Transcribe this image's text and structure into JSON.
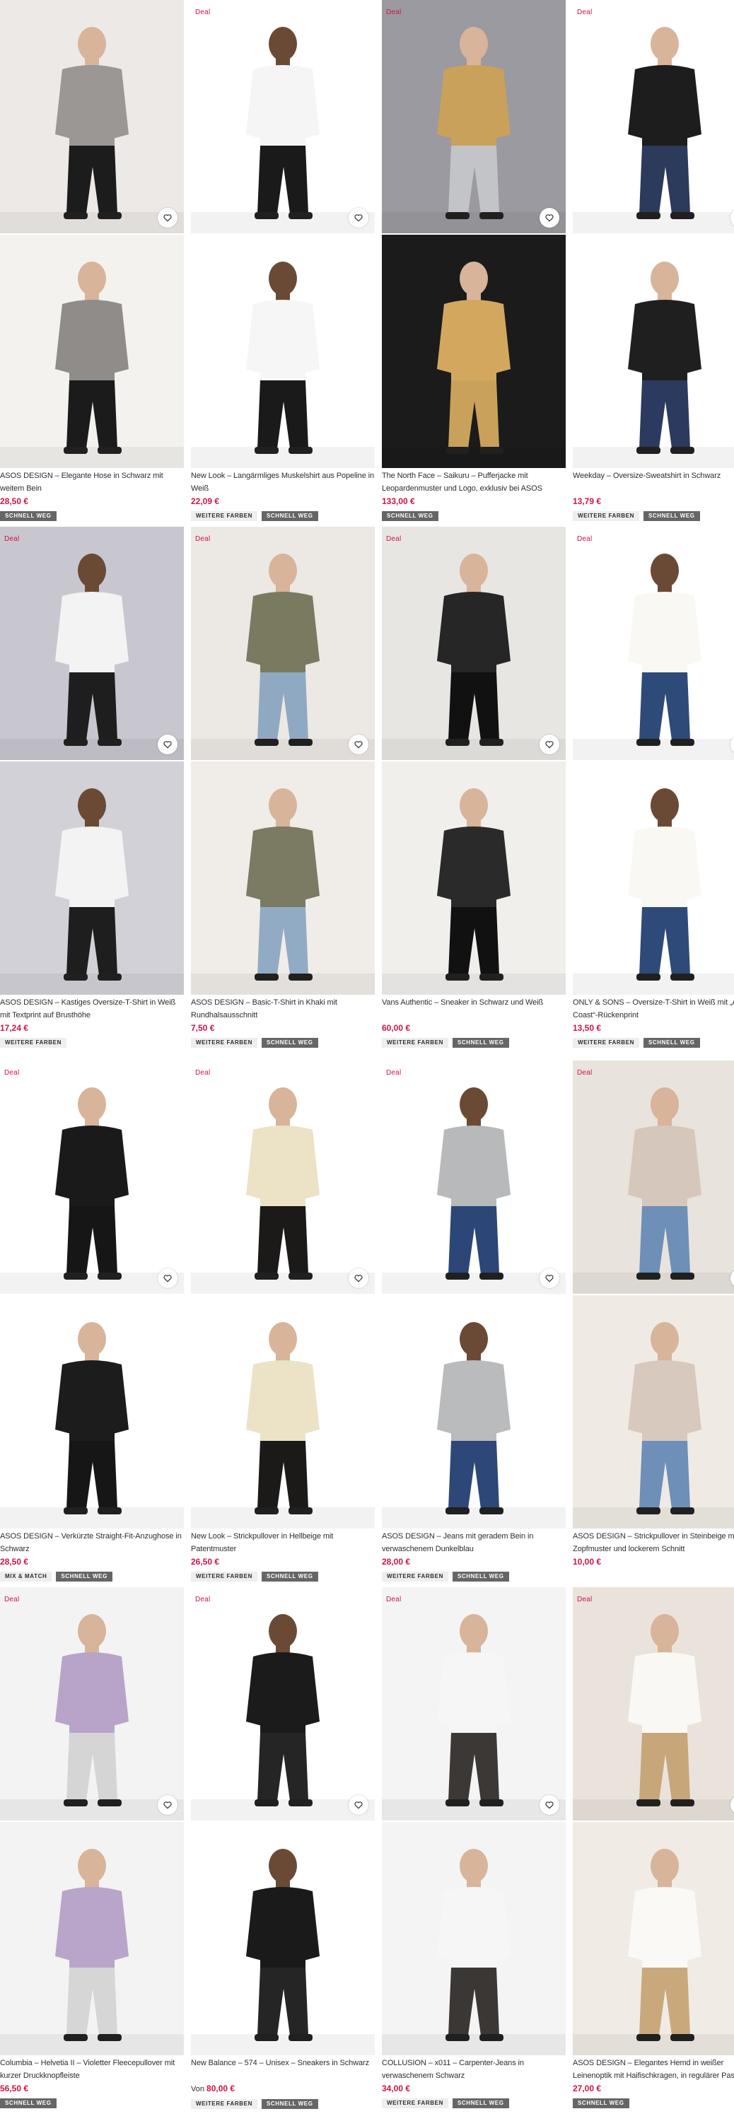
{
  "page": {
    "deal_label": "Deal"
  },
  "colors": {
    "deal_red": "#d01345",
    "text": "#2d2d2d",
    "badge_light": "#eeeeee",
    "badge_dark": "#666666"
  },
  "products": [
    {
      "name": "ASOS DESIGN – Elegante Hose in Schwarz mit weitem Bein",
      "price": "28,50 €",
      "from_label": "",
      "deal": false,
      "badges": [
        "SCHNELL WEG"
      ],
      "bg": "#ece9e6",
      "top": "#9a9795",
      "bottom": "#1d1c1c",
      "bg2": "#f4f2ef",
      "top2": "#8f8c8a",
      "bottom2": "#1c1b1b"
    },
    {
      "name": "New Look – Langärmliges Muskelshirt aus Popeline in Weiß",
      "price": "22,09 €",
      "from_label": "",
      "deal": true,
      "badges": [
        "WEITERE FARBEN",
        "SCHNELL WEG"
      ],
      "bg": "#ffffff",
      "top": "#f5f5f5",
      "bottom": "#1a1a1a",
      "bg2": "#ffffff",
      "top2": "#f6f6f6",
      "bottom2": "#1a1a1a"
    },
    {
      "name": "The North Face – Saikuru – Pufferjacke mit Leopardenmuster und Logo, exklusiv bei ASOS",
      "price": "133,00 €",
      "from_label": "",
      "deal": true,
      "badges": [
        "SCHNELL WEG"
      ],
      "bg": "#9a9aa0",
      "top": "#c9a15a",
      "bottom": "#c2c4c7",
      "bg2": "#1b1b1b",
      "top2": "#d3a85e",
      "bottom2": "#c9a15a"
    },
    {
      "name": "Weekday – Oversize-Sweatshirt in Schwarz",
      "price": "13,79 €",
      "from_label": "",
      "deal": true,
      "badges": [
        "WEITERE FARBEN",
        "SCHNELL WEG"
      ],
      "bg": "#ffffff",
      "top": "#1d1d1d",
      "bottom": "#2c3a5c",
      "bg2": "#ffffff",
      "top2": "#1f1f1f",
      "bottom2": "#2b3a5e"
    },
    {
      "name": "ASOS DESIGN – Kastiges Oversize-T-Shirt in Weiß mit Textprint auf Brusthöhe",
      "price": "17,24 €",
      "from_label": "",
      "deal": true,
      "badges": [
        "WEITERE FARBEN"
      ],
      "bg": "#c8c7cf",
      "top": "#f3f3f3",
      "bottom": "#1e1e1e",
      "bg2": "#d2d1d8",
      "top2": "#f3f3f3",
      "bottom2": "#1e1e1e"
    },
    {
      "name": "ASOS DESIGN – Basic-T-Shirt in Khaki mit Rundhalsausschnitt",
      "price": "7,50 €",
      "from_label": "",
      "deal": true,
      "badges": [
        "WEITERE FARBEN",
        "SCHNELL WEG"
      ],
      "bg": "#ece8e3",
      "top": "#7a7a60",
      "bottom": "#90a9c2",
      "bg2": "#f0ede8",
      "top2": "#7b7a62",
      "bottom2": "#92abc4"
    },
    {
      "name": "Vans Authentic – Sneaker in Schwarz und Weiß",
      "price": "60,00 €",
      "from_label": "",
      "deal": true,
      "badges": [
        "WEITERE FARBEN",
        "SCHNELL WEG"
      ],
      "bg": "#e8e6e3",
      "top": "#262626",
      "bottom": "#111111",
      "bg2": "#f1efec",
      "top2": "#2a2a2a",
      "bottom2": "#111111"
    },
    {
      "name": "ONLY & SONS – Oversize-T-Shirt in Weiß mit „Amalfi Coast“-Rückenprint",
      "price": "13,50 €",
      "from_label": "",
      "deal": true,
      "badges": [
        "WEITERE FARBEN",
        "SCHNELL WEG"
      ],
      "bg": "#ffffff",
      "top": "#faf8f3",
      "bottom": "#2e4a78",
      "bg2": "#ffffff",
      "top2": "#faf8f3",
      "bottom2": "#2e4a78"
    },
    {
      "name": "ASOS DESIGN – Verkürzte Straight-Fit-Anzughose in Schwarz",
      "price": "28,50 €",
      "from_label": "",
      "deal": true,
      "badges": [
        "MIX & MATCH",
        "SCHNELL WEG"
      ],
      "bg": "#ffffff",
      "top": "#1a1a1a",
      "bottom": "#161616",
      "bg2": "#ffffff",
      "top2": "#1c1c1c",
      "bottom2": "#161616"
    },
    {
      "name": "New Look – Strickpullover in Hellbeige mit Patentmuster",
      "price": "26,50 €",
      "from_label": "",
      "deal": true,
      "badges": [
        "WEITERE FARBEN",
        "SCHNELL WEG"
      ],
      "bg": "#ffffff",
      "top": "#ece2c6",
      "bottom": "#1c1a18",
      "bg2": "#ffffff",
      "top2": "#ece2c6",
      "bottom2": "#1c1a18"
    },
    {
      "name": "ASOS DESIGN – Jeans mit geradem Bein in verwaschenem Dunkelblau",
      "price": "28,00 €",
      "from_label": "",
      "deal": true,
      "badges": [
        "WEITERE FARBEN",
        "SCHNELL WEG"
      ],
      "bg": "#ffffff",
      "top": "#b7b9bb",
      "bottom": "#2c4678",
      "bg2": "#ffffff",
      "top2": "#b9bbbd",
      "bottom2": "#2d4779"
    },
    {
      "name": "ASOS DESIGN – Strickpullover in Steinbeige mit Zopfmuster und lockerem Schnitt",
      "price": "10,00 €",
      "from_label": "",
      "deal": true,
      "badges": [],
      "bg": "#e8e3dc",
      "top": "#d6c7bd",
      "bottom": "#6d8fb8",
      "bg2": "#efeae4",
      "top2": "#d8c9bf",
      "bottom2": "#6d8fb8"
    },
    {
      "name": "Columbia – Helvetia II – Violetter Fleecepullover mit kurzer Druckknopfleiste",
      "price": "56,50 €",
      "from_label": "",
      "deal": true,
      "badges": [
        "SCHNELL WEG"
      ],
      "bg": "#f3f3f3",
      "top": "#b8a4c8",
      "bottom": "#d5d5d5",
      "bg2": "#f3f3f3",
      "top2": "#b9a5c9",
      "bottom2": "#d6d6d6"
    },
    {
      "name": "New Balance – 574 – Unisex – Sneakers in Schwarz",
      "price": "80,00 €",
      "from_label": "Von",
      "deal": true,
      "badges": [
        "WEITERE FARBEN",
        "SCHNELL WEG"
      ],
      "bg": "#ffffff",
      "top": "#1b1b1b",
      "bottom": "#252525",
      "bg2": "#ffffff",
      "top2": "#1a1a1a",
      "bottom2": "#252525"
    },
    {
      "name": "COLLUSION – x011 – Carpenter-Jeans in verwaschenem Schwarz",
      "price": "34,00 €",
      "from_label": "",
      "deal": true,
      "badges": [
        "WEITERE FARBEN",
        "SCHNELL WEG"
      ],
      "bg": "#f4f4f4",
      "top": "#f6f6f6",
      "bottom": "#3b3836",
      "bg2": "#f4f4f4",
      "top2": "#f6f6f6",
      "bottom2": "#3a3735"
    },
    {
      "name": "ASOS DESIGN – Elegantes Hemd in weißer Leinenoptik mit Haifischkragen, in regulärer Passform",
      "price": "27,00 €",
      "from_label": "",
      "deal": true,
      "badges": [
        "SCHNELL WEG"
      ],
      "bg": "#e9e3db",
      "top": "#faf8f4",
      "bottom": "#c7a67a",
      "bg2": "#f0ebe4",
      "top2": "#fbf9f5",
      "bottom2": "#c9a97c"
    }
  ]
}
